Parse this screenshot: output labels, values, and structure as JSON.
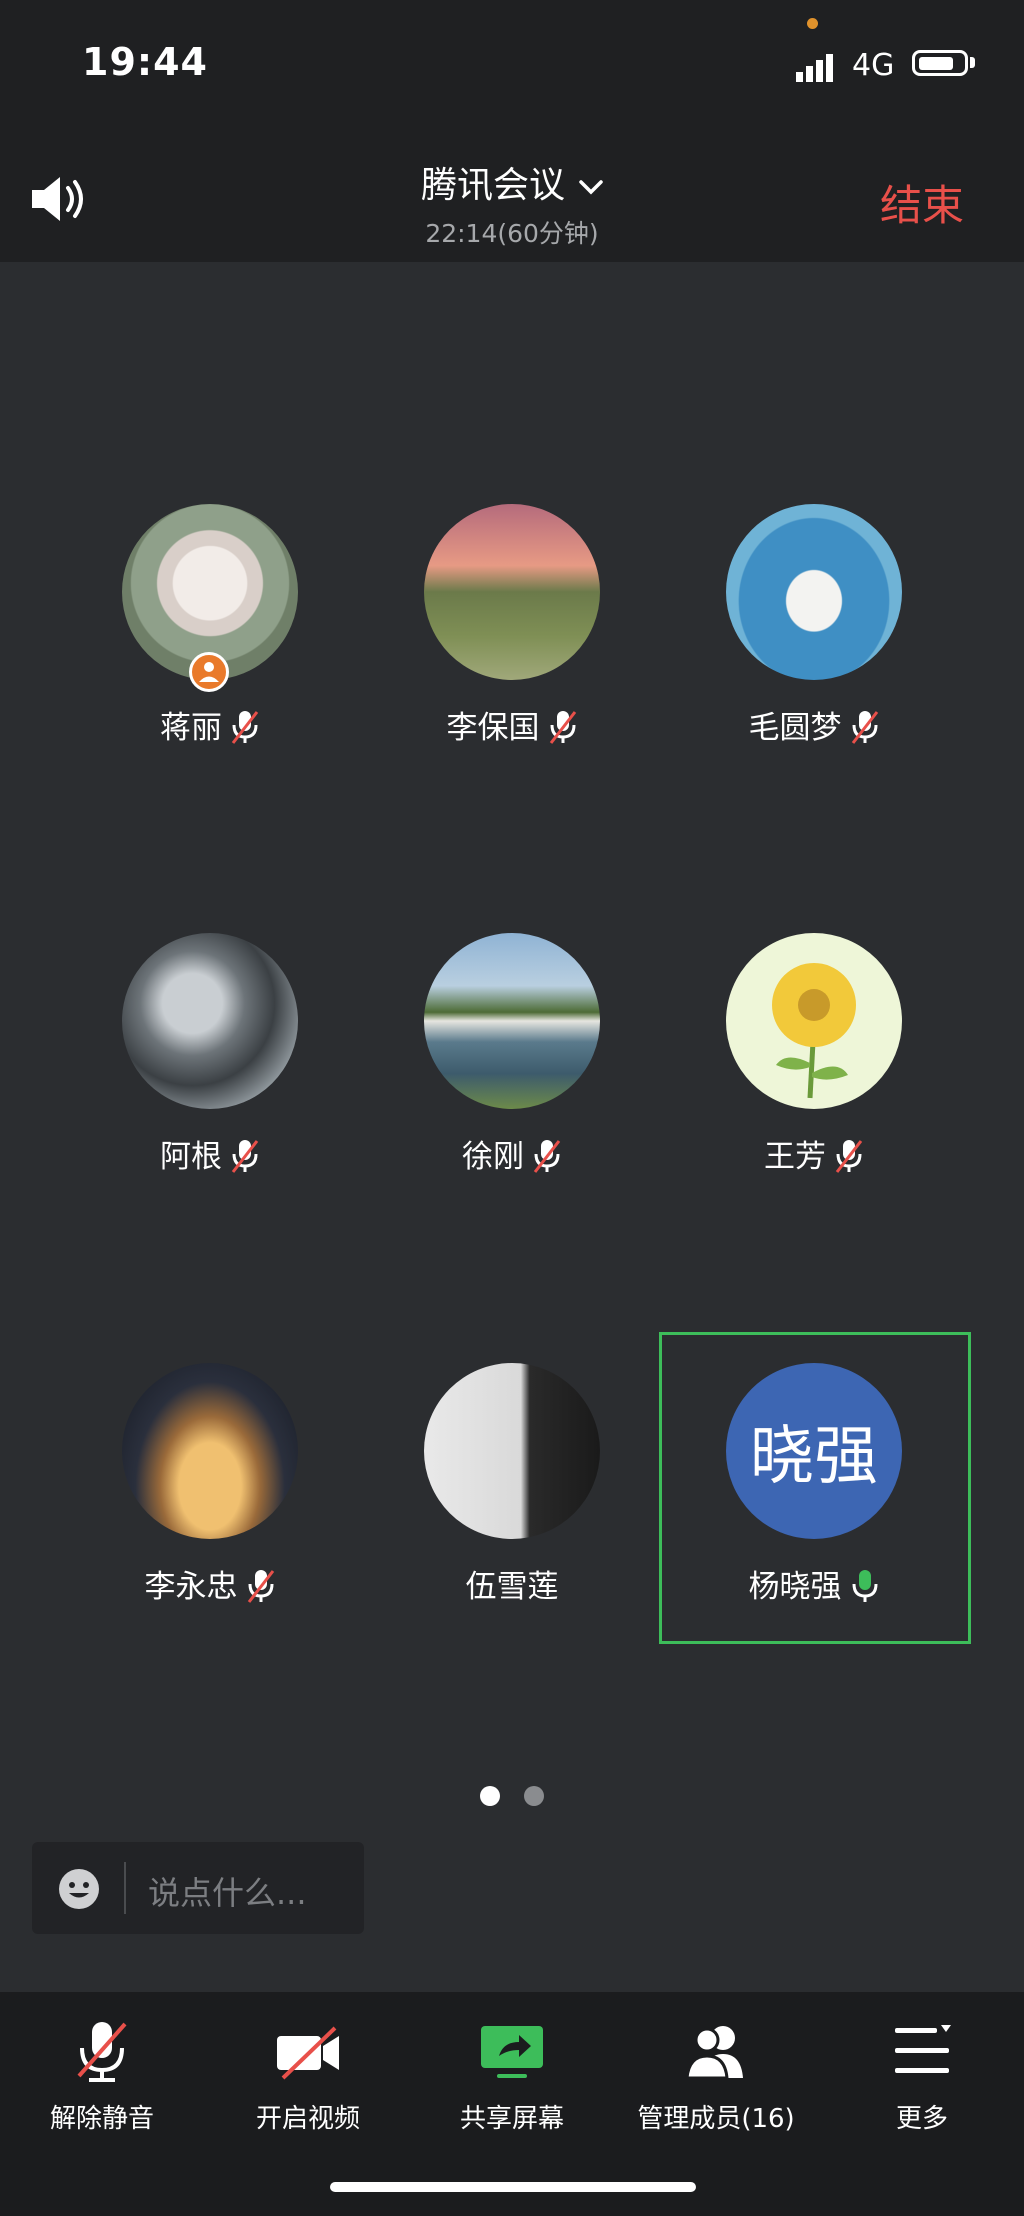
{
  "status_bar": {
    "time": "19:44",
    "network": "4G"
  },
  "header": {
    "title": "腾讯会议",
    "subtitle": "22:14(60分钟)",
    "end_label": "结束"
  },
  "participants": [
    {
      "name": "蒋丽",
      "mic": "muted",
      "host": true
    },
    {
      "name": "李保国",
      "mic": "muted"
    },
    {
      "name": "毛圆梦",
      "mic": "muted"
    },
    {
      "name": "阿根",
      "mic": "muted"
    },
    {
      "name": "徐刚",
      "mic": "muted"
    },
    {
      "name": "王芳",
      "mic": "muted"
    },
    {
      "name": "李永忠",
      "mic": "muted"
    },
    {
      "name": "伍雪莲",
      "mic": "none"
    },
    {
      "name": "杨晓强",
      "mic": "speaking",
      "avatar_text": "晓强",
      "avatar_color": "#3d66b3",
      "active": true
    }
  ],
  "pagination": {
    "current": 1,
    "total": 2
  },
  "chat": {
    "placeholder": "说点什么..."
  },
  "toolbar": {
    "unmute": "解除静音",
    "video": "开启视频",
    "share": "共享屏幕",
    "members": "管理成员(16)",
    "more": "更多"
  },
  "colors": {
    "accent_green": "#3dbd5a",
    "end_red": "#e8504a",
    "host_orange": "#e97a2b"
  }
}
